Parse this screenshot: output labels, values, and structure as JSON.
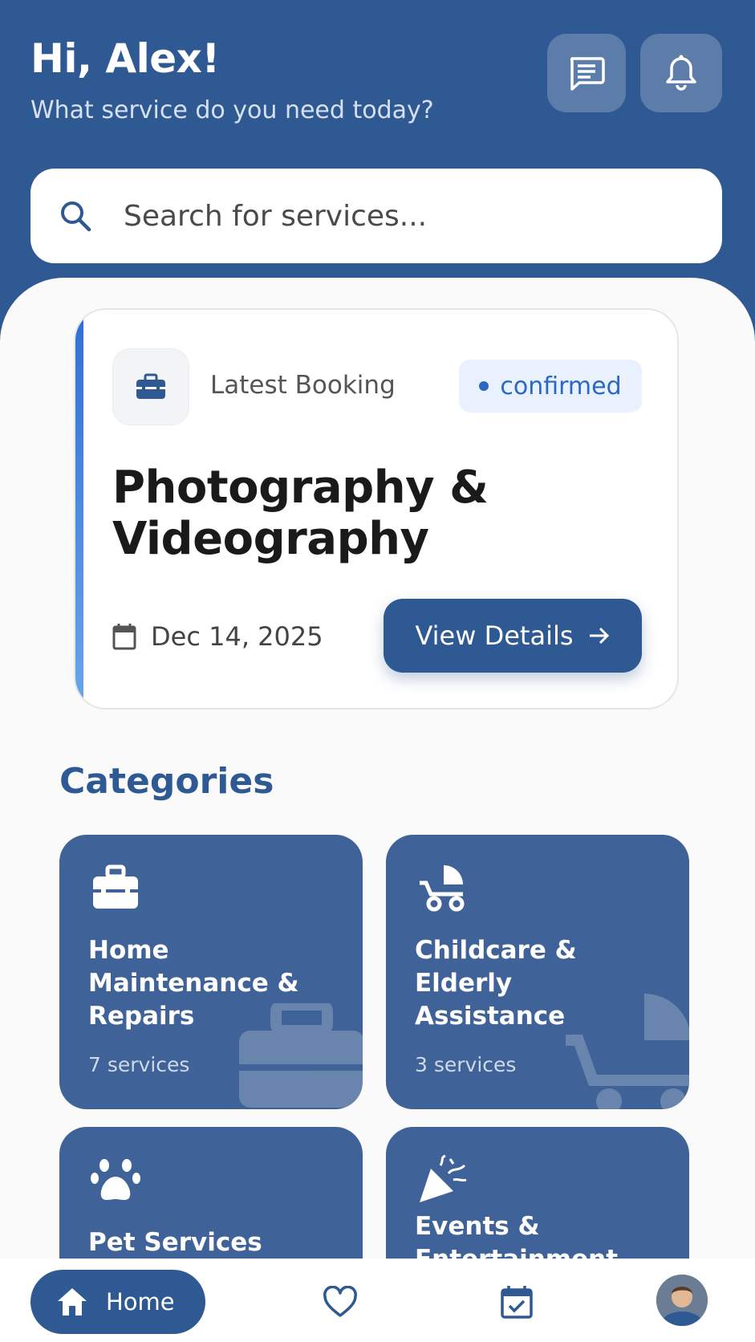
{
  "header": {
    "greeting": "Hi, Alex!",
    "subtitle": "What service do you need today?",
    "messages_icon": "chat-icon",
    "notifications_icon": "bell-icon"
  },
  "search": {
    "placeholder": "Search for services..."
  },
  "latest_booking": {
    "label": "Latest Booking",
    "status": "confirmed",
    "title": "Photography & Videography",
    "date": "Dec 14, 2025",
    "button_label": "View Details"
  },
  "categories": {
    "title": "Categories",
    "items": [
      {
        "name": "Home Maintenance & Repairs",
        "count": "7 services",
        "icon": "toolbox-icon"
      },
      {
        "name": "Childcare & Elderly Assistance",
        "count": "3 services",
        "icon": "stroller-icon"
      },
      {
        "name": "Pet Services",
        "count": "",
        "icon": "paw-icon"
      },
      {
        "name": "Events & Entertainment",
        "count": "",
        "icon": "party-popper-icon"
      }
    ]
  },
  "bottom_nav": {
    "home_label": "Home"
  },
  "colors": {
    "primary": "#2f5993",
    "accent": "#2a68c4",
    "badge_bg": "#e8f1fd",
    "card": "#3f6398"
  }
}
